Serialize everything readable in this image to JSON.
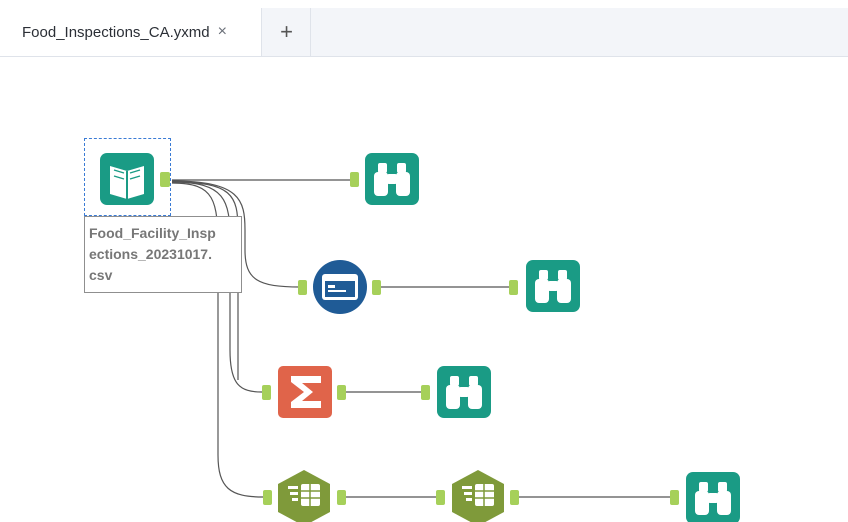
{
  "tabs": [
    {
      "title": "Food_Inspections_CA.yxmd",
      "close_icon": "×"
    }
  ],
  "add_tab_icon": "+",
  "input_tool": {
    "label_lines": [
      "Food_Facility_Insp",
      "ections_20231017.",
      "csv"
    ]
  },
  "tools": [
    {
      "id": "input",
      "type": "input-data",
      "color": "#1a9b85"
    },
    {
      "id": "browse-1",
      "type": "browse",
      "color": "#1a9b85"
    },
    {
      "id": "browse-2",
      "type": "browse",
      "color": "#1a9b85"
    },
    {
      "id": "browse-3",
      "type": "browse",
      "color": "#1a9b85"
    },
    {
      "id": "browse-4",
      "type": "browse",
      "color": "#1a9b85"
    },
    {
      "id": "select-records",
      "type": "select-records",
      "color": "#1f5b96"
    },
    {
      "id": "summarize",
      "type": "summarize",
      "color": "#e0644a"
    },
    {
      "id": "filter-1",
      "type": "filter",
      "color": "#7f9a3a"
    },
    {
      "id": "filter-2",
      "type": "filter",
      "color": "#7f9a3a"
    }
  ]
}
